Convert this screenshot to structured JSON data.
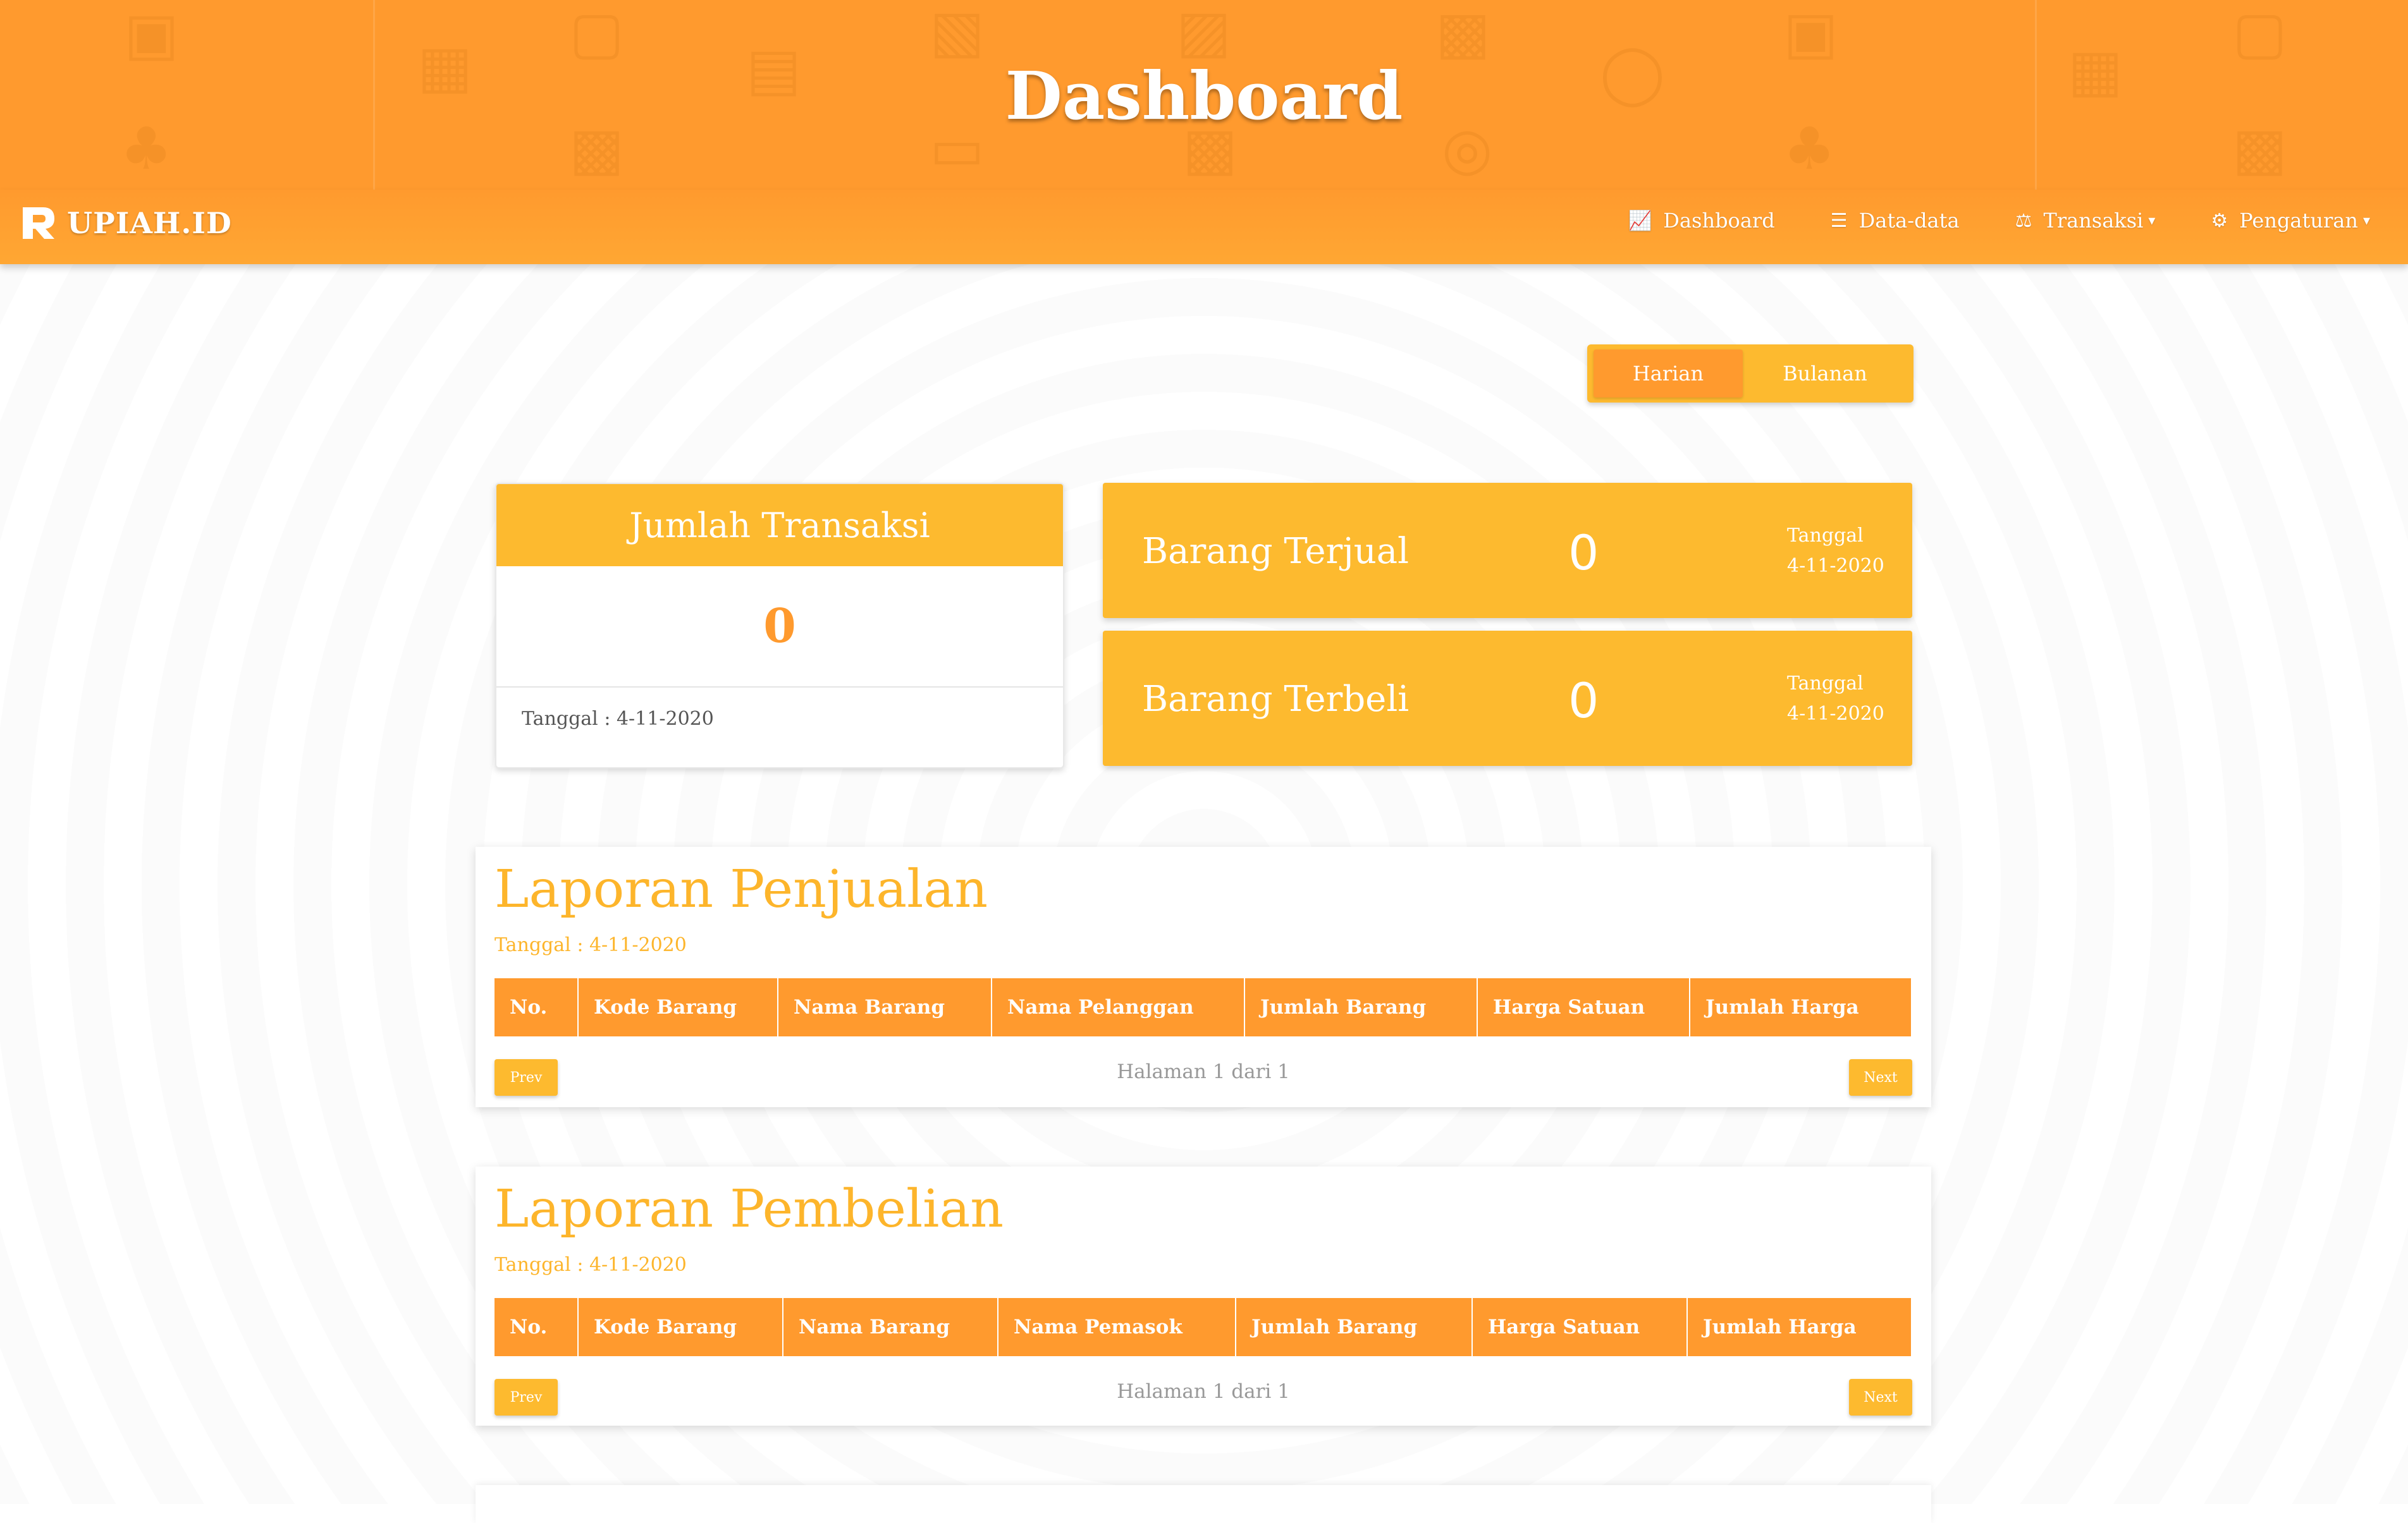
{
  "hero": {
    "title": "Dashboard"
  },
  "navbar": {
    "brand": "UPIAH.ID",
    "items": [
      {
        "label": "Dashboard",
        "icon": "chart-icon"
      },
      {
        "label": "Data-data",
        "icon": "database-icon"
      },
      {
        "label": "Transaksi",
        "icon": "scale-icon",
        "dropdown": true
      },
      {
        "label": "Pengaturan",
        "icon": "gear-icon",
        "dropdown": true
      }
    ]
  },
  "toggle": {
    "active": "Harian",
    "inactive": "Bulanan"
  },
  "summary": {
    "title": "Jumlah Transaksi",
    "value": "0",
    "date": "Tanggal : 4-11-2020"
  },
  "stats": [
    {
      "label": "Barang Terjual",
      "value": "0",
      "date_label": "Tanggal",
      "date": "4-11-2020"
    },
    {
      "label": "Barang Terbeli",
      "value": "0",
      "date_label": "Tanggal",
      "date": "4-11-2020"
    }
  ],
  "reports": [
    {
      "title": "Laporan Penjualan",
      "date": "Tanggal : 4-11-2020",
      "columns": [
        "No.",
        "Kode Barang",
        "Nama Barang",
        "Nama Pelanggan",
        "Jumlah Barang",
        "Harga Satuan",
        "Jumlah Harga"
      ],
      "prev": "Prev",
      "next": "Next",
      "page_info": "Halaman 1 dari 1"
    },
    {
      "title": "Laporan Pembelian",
      "date": "Tanggal : 4-11-2020",
      "columns": [
        "No.",
        "Kode Barang",
        "Nama Barang",
        "Nama Pemasok",
        "Jumlah Barang",
        "Harga Satuan",
        "Jumlah Harga"
      ],
      "prev": "Prev",
      "next": "Next",
      "page_info": "Halaman 1 dari 1"
    }
  ],
  "colors": {
    "orange": "#ff9a2e",
    "yellow": "#fdba2f",
    "title_yellow": "#fdb52b"
  }
}
